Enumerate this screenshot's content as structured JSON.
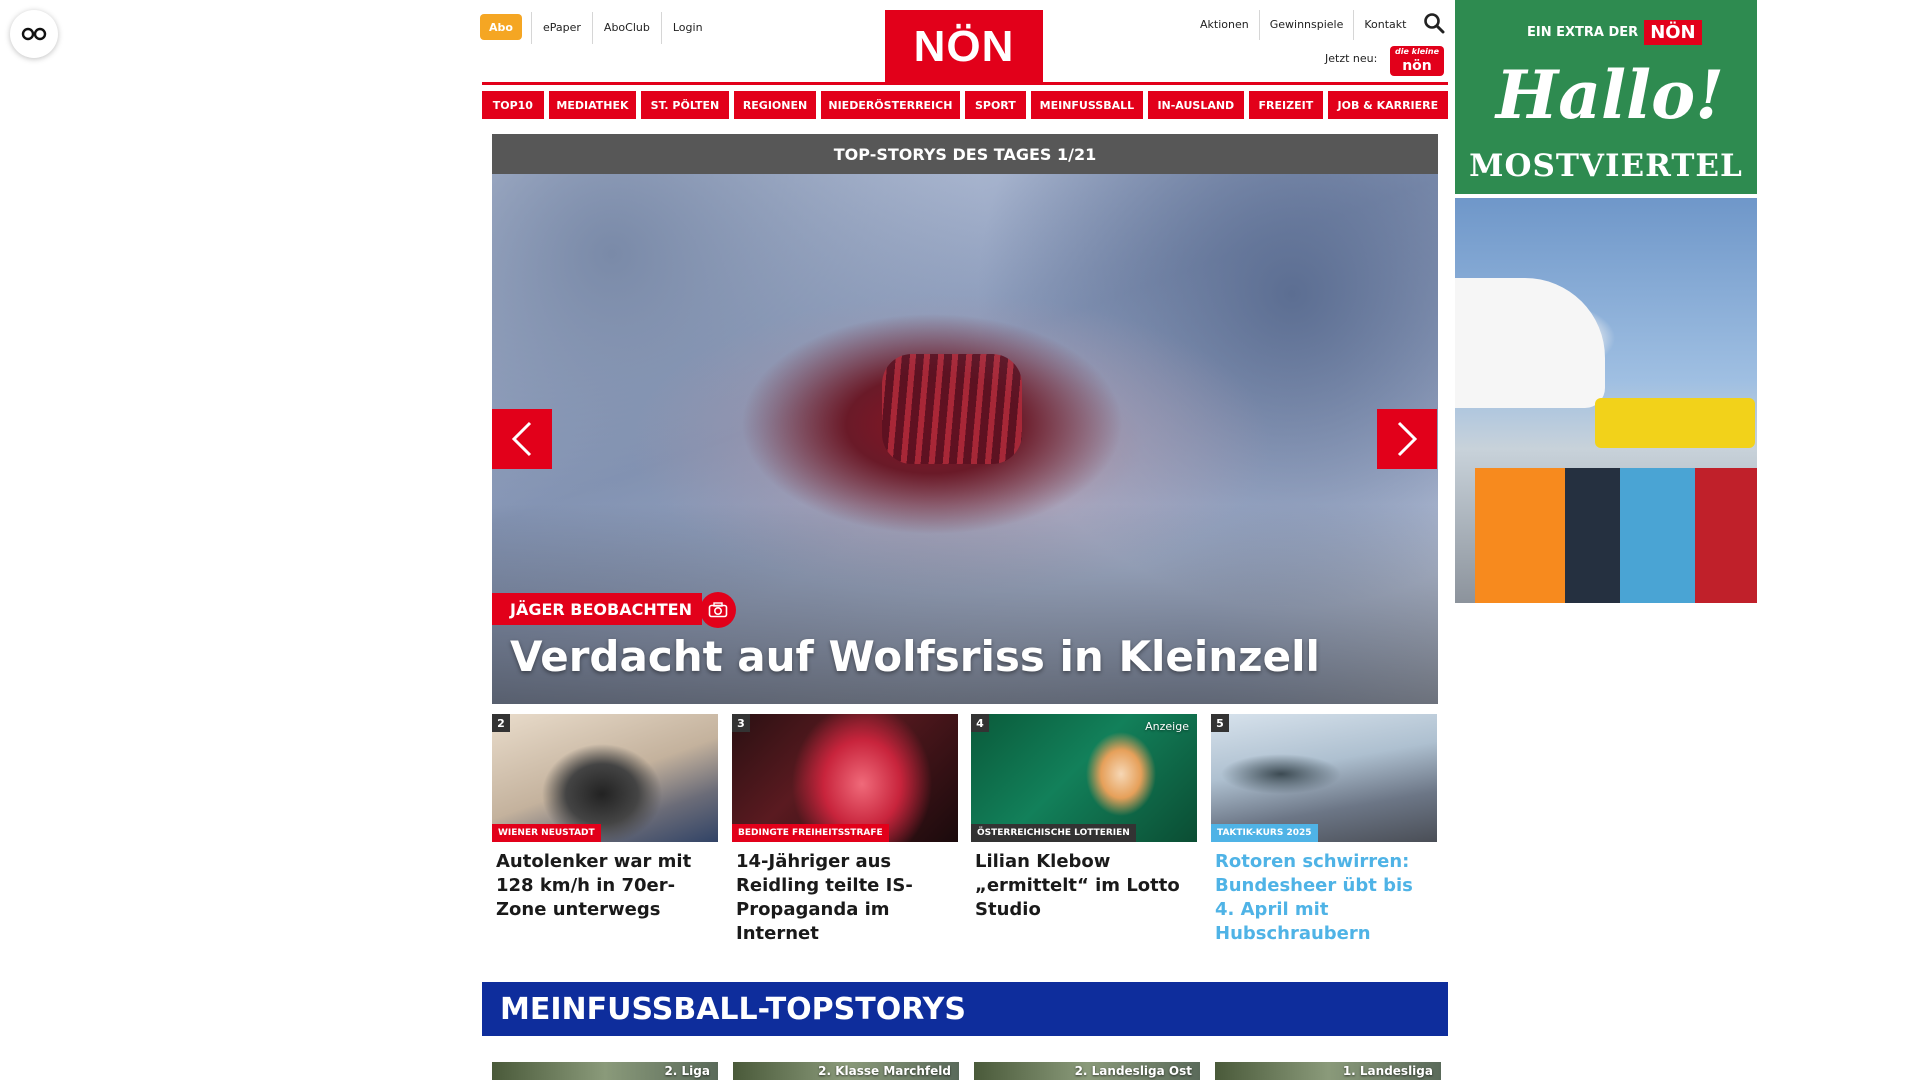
{
  "accessibility": {
    "icon": "glasses-icon"
  },
  "header": {
    "abo": "Abo",
    "links": [
      "ePaper",
      "AboClub",
      "Login"
    ],
    "logo": "NÖN",
    "right_links": [
      "Aktionen",
      "Gewinnspiele",
      "Kontakt"
    ],
    "jetzt_neu": "Jetzt neu:",
    "kleine_logo_top": "die kleine",
    "kleine_logo": "nön"
  },
  "nav": [
    "TOP10",
    "MEDIATHEK",
    "ST. PÖLTEN",
    "REGIONEN",
    "NIEDERÖSTERREICH",
    "SPORT",
    "MEINFUSSBALL",
    "IN-AUSLAND",
    "FREIZEIT",
    "JOB & KARRIERE"
  ],
  "hero": {
    "heading": "TOP-STORYS DES TAGES 1/21",
    "kicker": "JÄGER BEOBACHTEN",
    "title": "Verdacht auf Wolfsriss in Kleinzell"
  },
  "cards": [
    {
      "num": "2",
      "tag": "WIENER NEUSTADT",
      "title": "Autolenker war mit 128 km/h in 70er-Zone unterwegs",
      "tag_color": "#e2001a",
      "title_color": "#1a1a1a"
    },
    {
      "num": "3",
      "tag": "BEDINGTE FREIHEITSSTRAFE",
      "title": "14-Jähriger aus Reidling teilte IS-Propaganda im Internet",
      "tag_color": "#e2001a",
      "title_color": "#1a1a1a"
    },
    {
      "num": "4",
      "tag": "ÖSTERREICHISCHE LOTTERIEN",
      "title": "Lilian Klebow „ermittelt“ im Lotto Studio",
      "anzeige": "Anzeige",
      "tag_color": "#333333",
      "title_color": "#1a1a1a"
    },
    {
      "num": "5",
      "tag": "TAKTIK-KURS 2025",
      "title": "Rotoren schwirren: Bundesheer übt bis 4. April mit Hubschraubern",
      "tag_color": "#4fb3e6",
      "title_color": "#4fb3e6"
    }
  ],
  "meinfussball": {
    "title": "MEINFUSSBALL-TOPSTORYS",
    "labels": [
      "2. Liga",
      "2. Klasse Marchfeld",
      "2. Landesliga Ost",
      "1. Landesliga"
    ]
  },
  "ad": {
    "extra": "EIN EXTRA DER",
    "logo": "NÖN",
    "hallo": "Hallo!",
    "region": "MOSTVIERTEL"
  },
  "colors": {
    "brand_red": "#e2001a",
    "abo_orange": "#f5a623",
    "football_blue": "#0e2d9c",
    "ad_green": "#2e8b50"
  }
}
